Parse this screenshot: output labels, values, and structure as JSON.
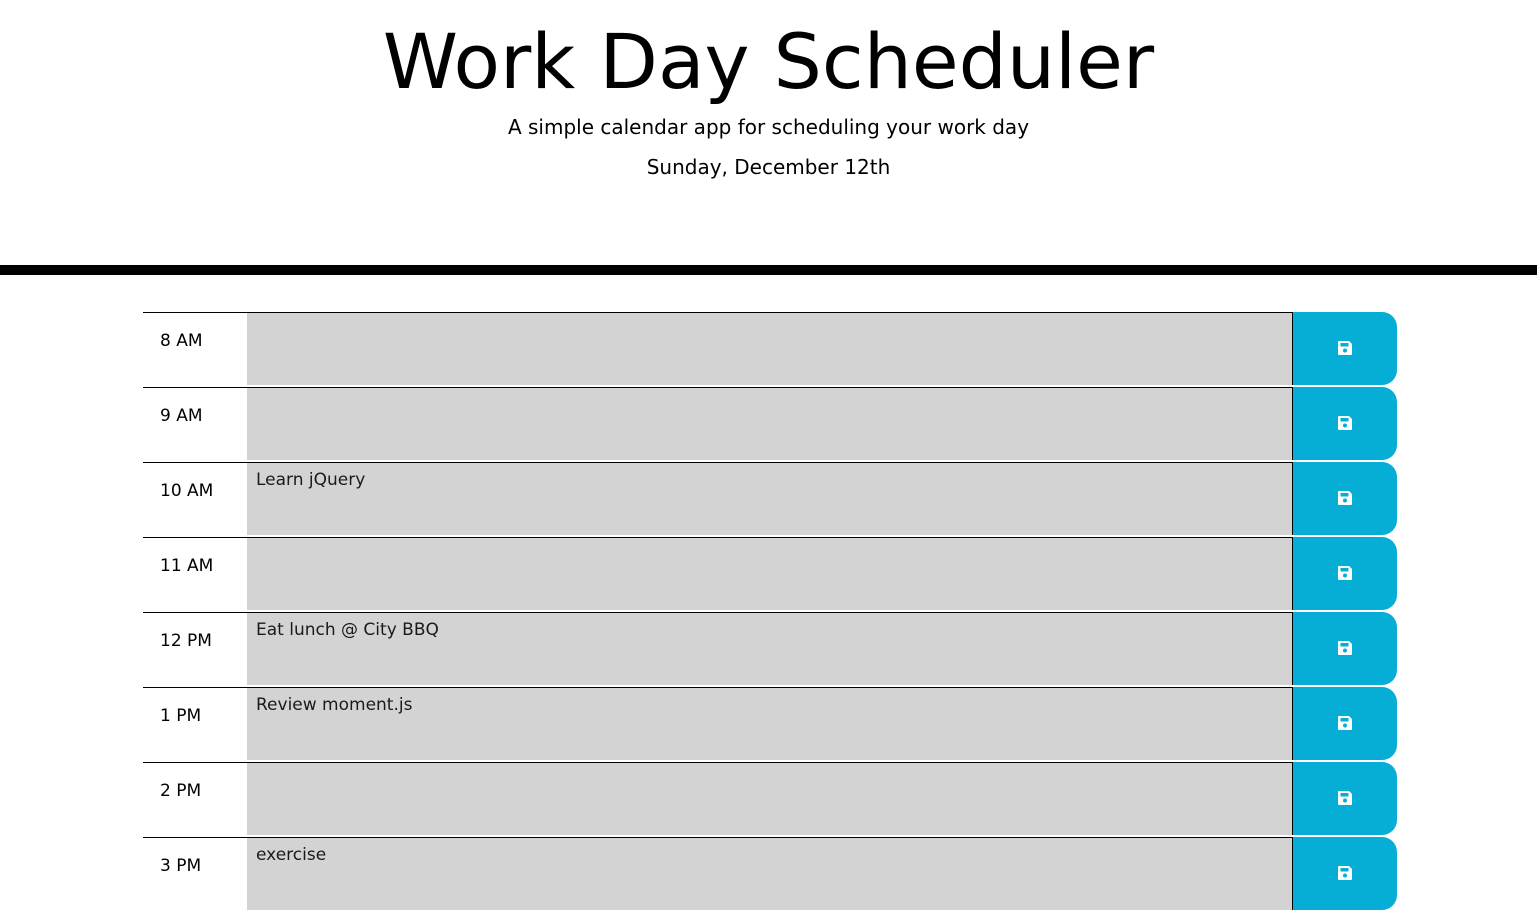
{
  "header": {
    "title": "Work Day Scheduler",
    "lead": "A simple calendar app for scheduling your work day",
    "current_day": "Sunday, December 12th"
  },
  "colors": {
    "description_bg": "#d3d3d3",
    "save_button": "#06aed5",
    "divider": "#000000"
  },
  "schedule": [
    {
      "hour": "8 AM",
      "text": ""
    },
    {
      "hour": "9 AM",
      "text": ""
    },
    {
      "hour": "10 AM",
      "text": "Learn jQuery"
    },
    {
      "hour": "11 AM",
      "text": ""
    },
    {
      "hour": "12 PM",
      "text": "Eat lunch @ City BBQ"
    },
    {
      "hour": "1 PM",
      "text": "Review moment.js"
    },
    {
      "hour": "2 PM",
      "text": ""
    },
    {
      "hour": "3 PM",
      "text": "exercise"
    }
  ],
  "save_icon": "save-icon"
}
